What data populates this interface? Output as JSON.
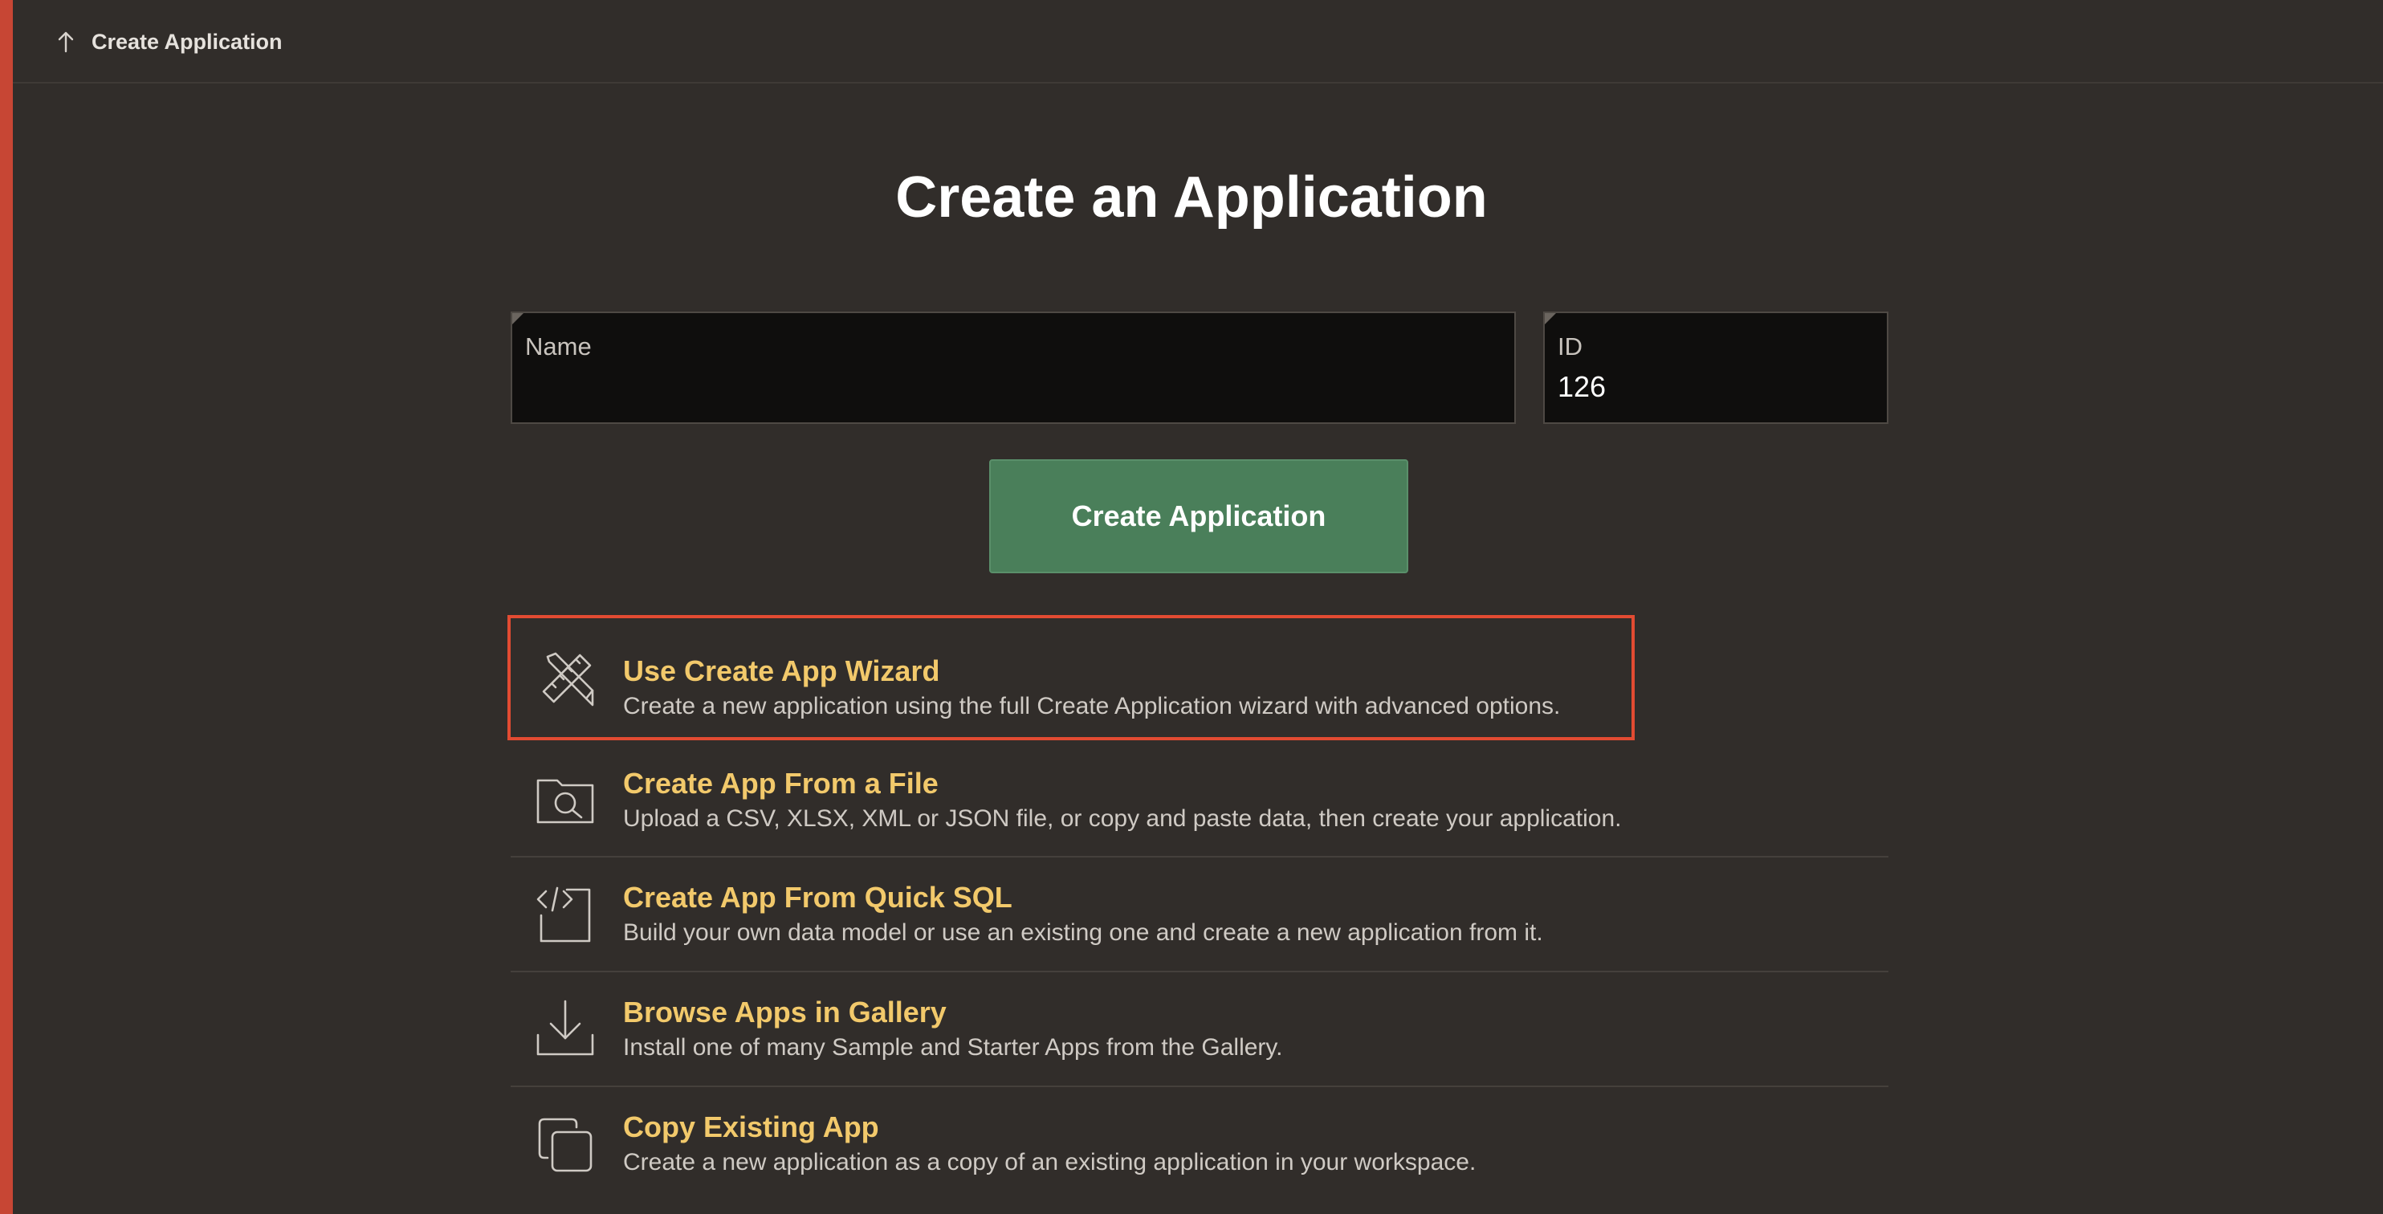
{
  "colors": {
    "accent_bar": "#c74634",
    "background": "#312d2a",
    "button": "#4a7f5a",
    "option_title": "#f2c96b",
    "highlight_border": "#e24b32"
  },
  "topbar": {
    "back_icon": "up-arrow-icon",
    "title": "Create Application"
  },
  "main": {
    "title": "Create an Application"
  },
  "form": {
    "name": {
      "label": "Name",
      "value": ""
    },
    "id": {
      "label": "ID",
      "value": "126"
    }
  },
  "button": {
    "label": "Create Application"
  },
  "options": [
    {
      "icon": "ruler-pencil-icon",
      "title": "Use Create App Wizard",
      "description": "Create a new application using the full Create Application wizard with advanced options."
    },
    {
      "icon": "folder-search-icon",
      "title": "Create App From a File",
      "description": "Upload a CSV, XLSX, XML or JSON file, or copy and paste data, then create your application."
    },
    {
      "icon": "code-file-icon",
      "title": "Create App From Quick SQL",
      "description": "Build your own data model or use an existing one and create a new application from it."
    },
    {
      "icon": "download-icon",
      "title": "Browse Apps in Gallery",
      "description": "Install one of many Sample and Starter Apps from the Gallery."
    },
    {
      "icon": "copy-icon",
      "title": "Copy Existing App",
      "description": "Create a new application as a copy of an existing application in your workspace."
    }
  ]
}
